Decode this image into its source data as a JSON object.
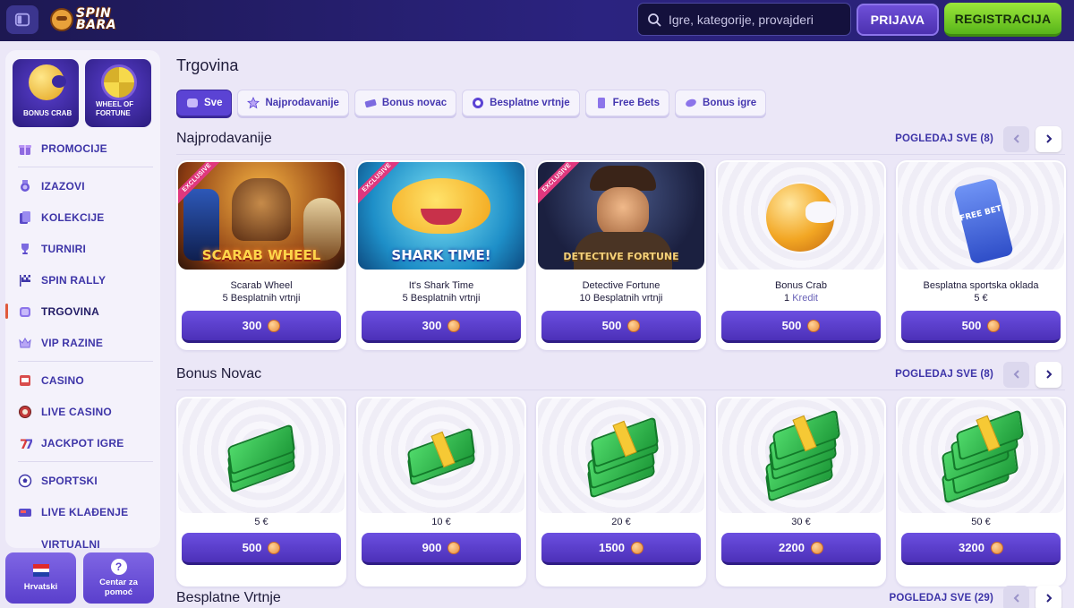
{
  "header": {
    "logo_line1": "SPIN",
    "logo_line2": "BARA",
    "search_placeholder": "Igre, kategorije, provajderi",
    "login_label": "PRIJAVA",
    "register_label": "REGISTRACIJA"
  },
  "sidebar": {
    "tiles": [
      {
        "label": "BONUS CRAB",
        "icon": "crab-coin-icon"
      },
      {
        "label": "WHEEL OF FORTUNE",
        "icon": "fortune-wheel-icon"
      }
    ],
    "items": [
      {
        "label": "PROMOCIJE",
        "icon": "gift-icon"
      },
      {
        "label": "IZAZOVI",
        "icon": "medal-icon"
      },
      {
        "label": "KOLEKCIJE",
        "icon": "cards-icon"
      },
      {
        "label": "TURNIRI",
        "icon": "trophy-icon"
      },
      {
        "label": "SPIN RALLY",
        "icon": "checkered-flag-icon"
      },
      {
        "label": "TRGOVINA",
        "icon": "shop-icon",
        "active": true
      },
      {
        "label": "VIP RAZINE",
        "icon": "crown-icon"
      },
      {
        "label": "CASINO",
        "icon": "slot-machine-icon"
      },
      {
        "label": "LIVE CASINO",
        "icon": "roulette-icon"
      },
      {
        "label": "JACKPOT IGRE",
        "icon": "seven-icon"
      },
      {
        "label": "SPORTSKI",
        "icon": "soccer-ball-icon"
      },
      {
        "label": "LIVE KLAĐENJE",
        "icon": "live-tv-icon"
      },
      {
        "label": "VIRTUALNI",
        "icon": "virtual-icon"
      }
    ],
    "language_label": "Hrvatski",
    "help_label": "Centar za pomoć"
  },
  "main": {
    "title": "Trgovina",
    "filters": [
      {
        "label": "Sve",
        "active": true
      },
      {
        "label": "Najprodavanije"
      },
      {
        "label": "Bonus novac"
      },
      {
        "label": "Besplatne vrtnje"
      },
      {
        "label": "Free Bets"
      },
      {
        "label": "Bonus igre"
      }
    ],
    "sections": [
      {
        "title": "Najprodavanije",
        "see_all": "POGLEDAJ SVE (8)",
        "cards": [
          {
            "name": "Scarab Wheel",
            "qty": "5",
            "unit": "Besplatnih vrtnji",
            "price": "300",
            "badge": "EXCLUSIVE",
            "art_title": "SCARAB WHEEL"
          },
          {
            "name": "It's Shark Time",
            "qty": "5",
            "unit": "Besplatnih vrtnji",
            "price": "300",
            "badge": "EXCLUSIVE",
            "art_title": "SHARK TIME!"
          },
          {
            "name": "Detective Fortune",
            "qty": "10",
            "unit": "Besplatnih vrtnji",
            "price": "500",
            "badge": "EXCLUSIVE",
            "art_title": "DETECTIVE FORTUNE"
          },
          {
            "name": "Bonus Crab",
            "qty": "1",
            "unit": "Kredit",
            "price": "500"
          },
          {
            "name": "Besplatna sportska oklada",
            "qty": "5 €",
            "unit": "",
            "price": "500",
            "art_title": "FREE BET"
          }
        ]
      },
      {
        "title": "Bonus Novac",
        "see_all": "POGLEDAJ SVE (8)",
        "cards": [
          {
            "amount": "5 €",
            "price": "500"
          },
          {
            "amount": "10 €",
            "price": "900"
          },
          {
            "amount": "20 €",
            "price": "1500"
          },
          {
            "amount": "30 €",
            "price": "2200"
          },
          {
            "amount": "50 €",
            "price": "3200"
          }
        ]
      },
      {
        "title": "Besplatne Vrtnje",
        "see_all": "POGLEDAJ SVE (29)"
      }
    ]
  },
  "colors": {
    "accent": "#5b43d4",
    "register": "#7dd22c",
    "exclusive_badge": "#e0387e",
    "coin": "#e98c3a"
  }
}
